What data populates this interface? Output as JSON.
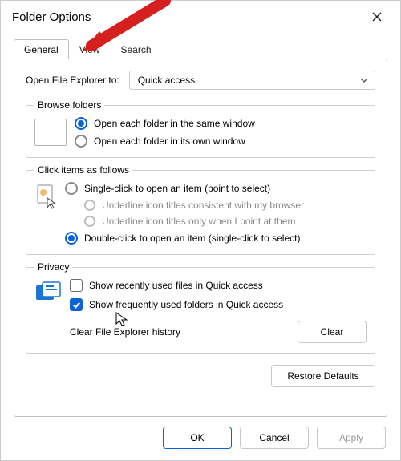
{
  "title": "Folder Options",
  "tabs": {
    "general": "General",
    "view": "View",
    "search": "Search"
  },
  "open": {
    "label": "Open File Explorer to:",
    "value": "Quick access"
  },
  "browse": {
    "legend": "Browse folders",
    "same": "Open each folder in the same window",
    "own": "Open each folder in its own window"
  },
  "click": {
    "legend": "Click items as follows",
    "single": "Single-click to open an item (point to select)",
    "u1": "Underline icon titles consistent with my browser",
    "u2": "Underline icon titles only when I point at them",
    "double": "Double-click to open an item (single-click to select)"
  },
  "privacy": {
    "legend": "Privacy",
    "recent": "Show recently used files in Quick access",
    "frequent": "Show frequently used folders in Quick access",
    "historyLabel": "Clear File Explorer history",
    "clear": "Clear"
  },
  "restore": "Restore Defaults",
  "footer": {
    "ok": "OK",
    "cancel": "Cancel",
    "apply": "Apply"
  }
}
